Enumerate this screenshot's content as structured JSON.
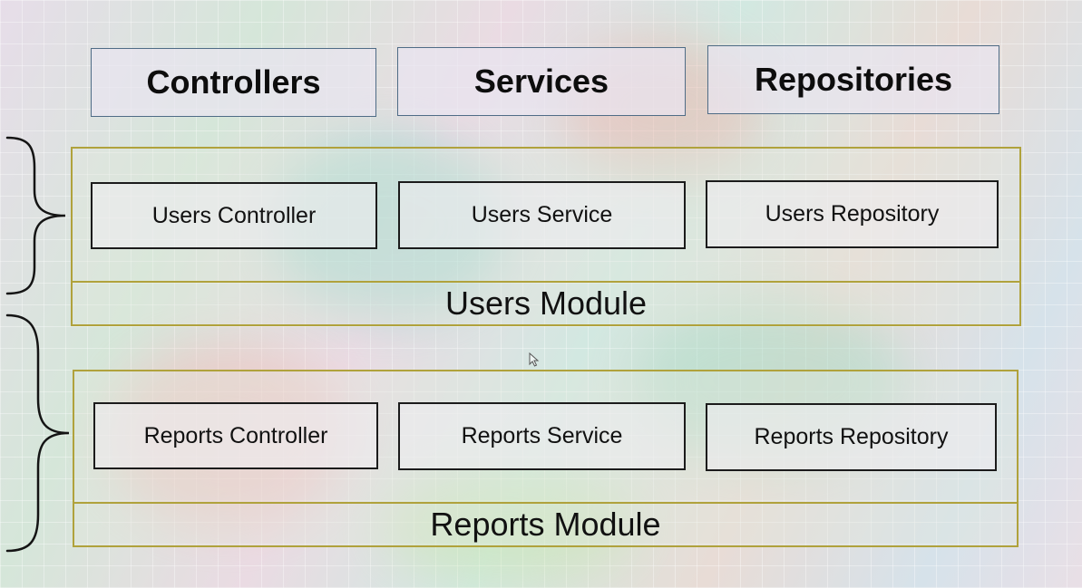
{
  "layer_headers": [
    "Controllers",
    "Services",
    "Repositories"
  ],
  "modules": [
    {
      "name": "Users Module",
      "components": [
        "Users Controller",
        "Users Service",
        "Users Repository"
      ]
    },
    {
      "name": "Reports Module",
      "components": [
        "Reports Controller",
        "Reports Service",
        "Reports Repository"
      ]
    }
  ],
  "colors": {
    "module_border": "#b0a23c",
    "header_border": "#4f6c86",
    "component_border": "#1b1b1b"
  }
}
